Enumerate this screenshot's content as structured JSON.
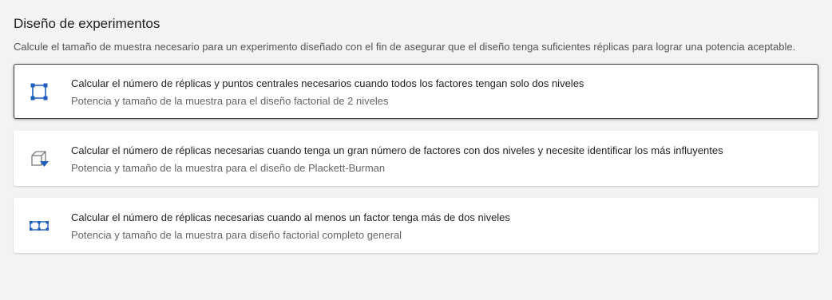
{
  "page": {
    "title": "Diseño de experimentos",
    "subtitle": "Calcule el tamaño de muestra necesario para un experimento diseñado con el fin de asegurar que el diseño tenga suficientes réplicas para lograr una potencia aceptable."
  },
  "options": [
    {
      "icon": "factorial-square-icon",
      "label": "Calcular el número de réplicas y puntos centrales necesarios cuando todos los factores tengan solo dos niveles",
      "description": "Potencia y tamaño de la muestra para el diseño factorial de 2 niveles",
      "selected": true
    },
    {
      "icon": "cube-funnel-icon",
      "label": "Calcular el número de réplicas necesarias cuando tenga un gran número de factores con dos niveles y necesite identificar los más influyentes",
      "description": "Potencia y tamaño de la muestra para el diseño de Plackett-Burman",
      "selected": false
    },
    {
      "icon": "general-factorial-icon",
      "label": "Calcular el número de réplicas necesarias cuando al menos un factor tenga más de dos niveles",
      "description": "Potencia y tamaño de la muestra para diseño factorial completo general",
      "selected": false
    }
  ],
  "colors": {
    "background": "#f3f3f3",
    "card": "#ffffff",
    "icon_blue": "#1f5fbf",
    "icon_gray": "#7a7a7a"
  }
}
